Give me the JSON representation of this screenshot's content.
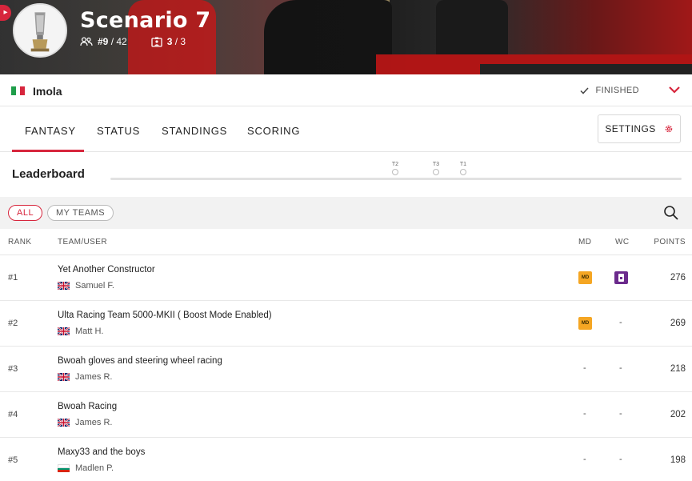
{
  "hero": {
    "title": "Scenario 7",
    "rank_label": "#9",
    "rank_total": "/ 42",
    "teams_count": "3",
    "teams_total": "/ 3"
  },
  "location": {
    "name": "Imola",
    "status": "FINISHED",
    "flag": "italy",
    "status_color": "#555555",
    "accent": "#d7263d"
  },
  "tabs": [
    {
      "label": "FANTASY",
      "active": true
    },
    {
      "label": "STATUS",
      "active": false
    },
    {
      "label": "STANDINGS",
      "active": false
    },
    {
      "label": "SCORING",
      "active": false
    }
  ],
  "settings_label": "SETTINGS",
  "leaderboard": {
    "title": "Leaderboard",
    "markers": [
      "T2",
      "T3",
      "T1"
    ]
  },
  "filters": {
    "all_label": "ALL",
    "my_teams_label": "MY TEAMS"
  },
  "table": {
    "headers": {
      "rank": "RANK",
      "team": "TEAM/USER",
      "md": "MD",
      "wc": "WC",
      "points": "POINTS"
    },
    "md_badge_text": "MD",
    "rows": [
      {
        "rank": "#1",
        "team": "Yet Another Constructor",
        "user": "Samuel F.",
        "flag": "uk",
        "md": "badge",
        "wc": "badge",
        "points": "276"
      },
      {
        "rank": "#2",
        "team": "Ulta Racing Team 5000-MKII ( Boost Mode Enabled)",
        "user": "Matt H.",
        "flag": "uk",
        "md": "badge",
        "wc": "-",
        "points": "269"
      },
      {
        "rank": "#3",
        "team": "Bwoah gloves and steering wheel racing",
        "user": "James R.",
        "flag": "uk",
        "md": "-",
        "wc": "-",
        "points": "218"
      },
      {
        "rank": "#4",
        "team": "Bwoah Racing",
        "user": "James R.",
        "flag": "uk",
        "md": "-",
        "wc": "-",
        "points": "202"
      },
      {
        "rank": "#5",
        "team": "Maxy33 and the boys",
        "user": "Madlen P.",
        "flag": "bulgaria",
        "md": "-",
        "wc": "-",
        "points": "198"
      }
    ]
  }
}
